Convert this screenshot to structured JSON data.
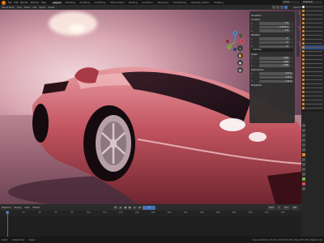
{
  "menu": {
    "items": [
      "File",
      "Edit",
      "Render",
      "Window",
      "Help"
    ],
    "tabs": [
      "Layout",
      "Modeling",
      "Sculpting",
      "UV Editing",
      "Texture Paint",
      "Shading",
      "Animation",
      "Rendering",
      "Compositing",
      "Geometry Nodes",
      "Scripting"
    ],
    "active_tab": "Layout",
    "scene": "Scene",
    "view_layer": "ViewLayer"
  },
  "viewport_header": {
    "mode": "Object Mode",
    "items": [
      "View",
      "Select",
      "Add",
      "Object"
    ],
    "transform_orientation": "Global",
    "options_label": "Options"
  },
  "n_panel": {
    "tabs": [
      "Item",
      "Tool",
      "View"
    ],
    "transform_title": "Transform",
    "location_title": "Location:",
    "location": [
      {
        "axis": "X",
        "value": "0 m"
      },
      {
        "axis": "Y",
        "value": "-0.7473 m"
      },
      {
        "axis": "Z",
        "value": "0 m"
      }
    ],
    "rotation_title": "Rotation:",
    "rotation": [
      {
        "axis": "X",
        "value": "0°"
      },
      {
        "axis": "Y",
        "value": "0°"
      },
      {
        "axis": "Z",
        "value": "0°"
      }
    ],
    "rotation_mode": "XYZ Euler",
    "scale_title": "Scale:",
    "scale": [
      {
        "axis": "X",
        "value": "1.000"
      },
      {
        "axis": "Y",
        "value": "1.000"
      },
      {
        "axis": "Z",
        "value": "1.000"
      }
    ],
    "dimensions_title": "Dimensions:",
    "dimensions": [
      {
        "axis": "X",
        "value": "4.53 m"
      },
      {
        "axis": "Y",
        "value": "1.98 m"
      },
      {
        "axis": "Z",
        "value": "1.15 m"
      }
    ],
    "properties_title": "Properties"
  },
  "gizmo": {
    "x": "X",
    "y": "Y",
    "z": "Z"
  },
  "timeline": {
    "menu": [
      "Playback",
      "Keying",
      "View",
      "Marker"
    ],
    "current_frame": "1",
    "start_label": "Start",
    "start": "1",
    "end_label": "End",
    "end": "250",
    "ticks": [
      "0",
      "20",
      "40",
      "60",
      "80",
      "100",
      "120",
      "140",
      "160",
      "180",
      "200",
      "220",
      "240",
      "260",
      "280",
      "300",
      "320",
      "340"
    ]
  },
  "statusbar": {
    "left": "Select",
    "mid": "Rotate View",
    "right_hint": "Object",
    "stats": "Scene Collection | Ferrari | Verts 871,254 | Faces 857,338 | Objects 1/24"
  },
  "colors": {
    "accent": "#4772b3",
    "car_body": "#c2545f",
    "background": "#d9a7b2"
  }
}
